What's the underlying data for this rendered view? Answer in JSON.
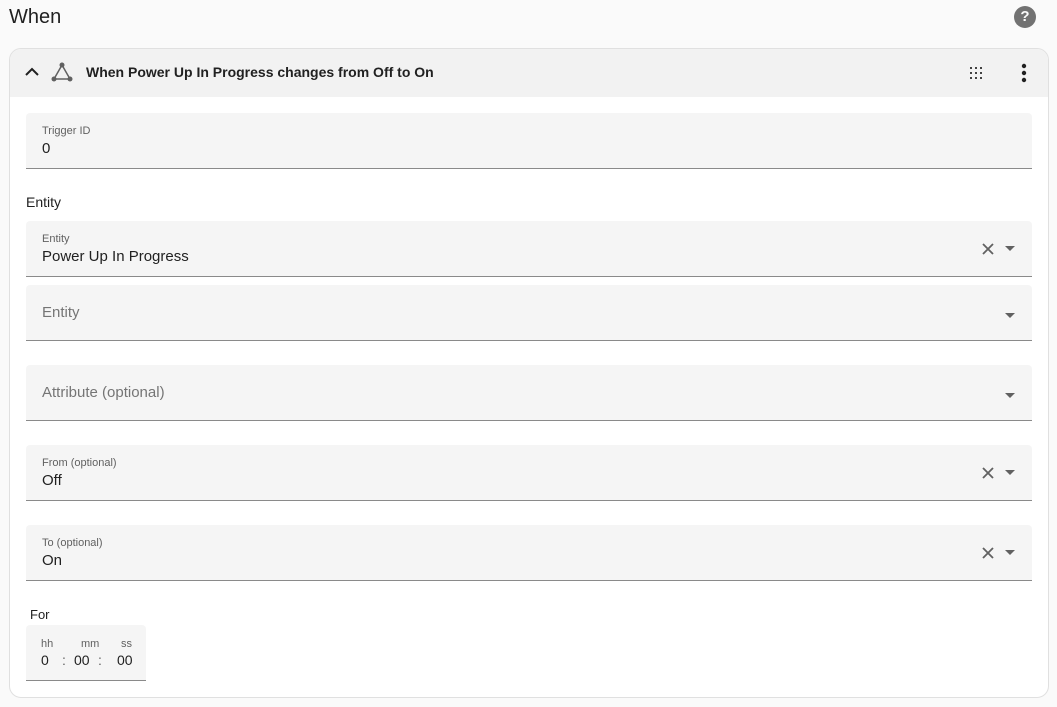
{
  "section": {
    "title": "When"
  },
  "trigger": {
    "title": "When Power Up In Progress changes from Off to On",
    "trigger_id": {
      "label": "Trigger ID",
      "value": "0"
    },
    "entity_heading": "Entity",
    "entity_fields": [
      {
        "label": "Entity",
        "value": "Power Up In Progress"
      },
      {
        "placeholder": "Entity"
      }
    ],
    "attribute": {
      "placeholder": "Attribute (optional)"
    },
    "from": {
      "label": "From (optional)",
      "value": "Off"
    },
    "to": {
      "label": "To (optional)",
      "value": "On"
    },
    "for": {
      "heading": "For",
      "hours": {
        "unit": "hh",
        "value": "0"
      },
      "minutes": {
        "unit": "mm",
        "value": "00"
      },
      "seconds": {
        "unit": "ss",
        "value": "00"
      },
      "separator": ":"
    }
  },
  "icons": {
    "help": "help-circle-icon",
    "collapse": "chevron-up-icon",
    "trigger": "state-graph-icon",
    "drag": "drag-handle-icon",
    "menu": "dots-vertical-icon",
    "clear": "close-icon",
    "dropdown": "menu-down-icon"
  },
  "colors": {
    "field_bg": "#f5f5f5",
    "header_bg": "#f2f2f2",
    "icon": "#616161"
  }
}
